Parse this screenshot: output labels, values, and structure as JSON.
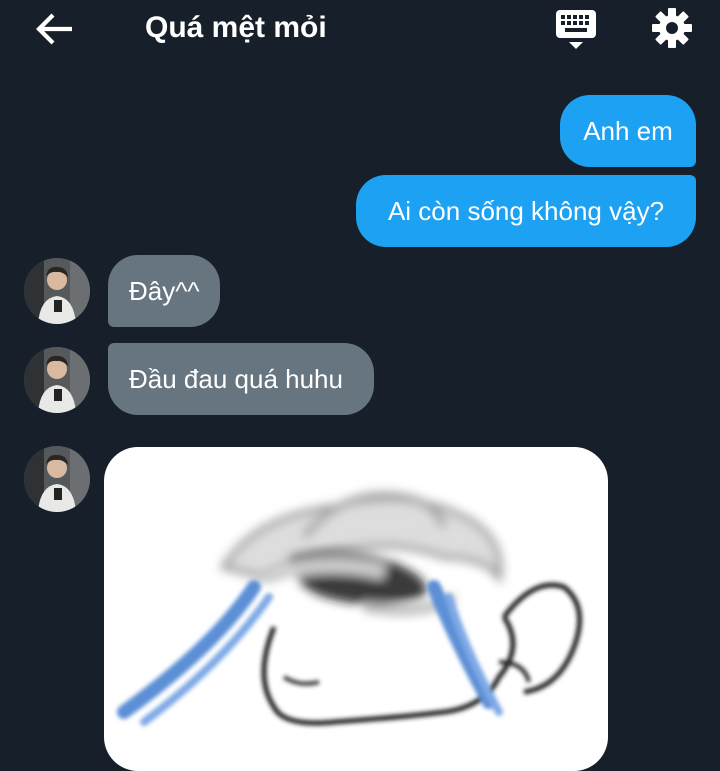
{
  "header": {
    "title": "Quá mệt mỏi",
    "back_icon": "arrow-left-icon",
    "keyboard_icon": "keyboard-icon",
    "settings_icon": "gear-icon"
  },
  "colors": {
    "background": "#17202a",
    "outgoing_bubble": "#1da1f2",
    "incoming_bubble": "#66757f",
    "text": "#ffffff"
  },
  "messages": [
    {
      "direction": "outgoing",
      "text": "Anh em"
    },
    {
      "direction": "outgoing",
      "text": "Ai còn sống không vậy?"
    },
    {
      "direction": "incoming",
      "text": "Đây^^"
    },
    {
      "direction": "incoming",
      "text": "Đầu đau quá huhu"
    },
    {
      "direction": "incoming",
      "type": "sticker",
      "sticker": "crying-face-sticker"
    }
  ]
}
